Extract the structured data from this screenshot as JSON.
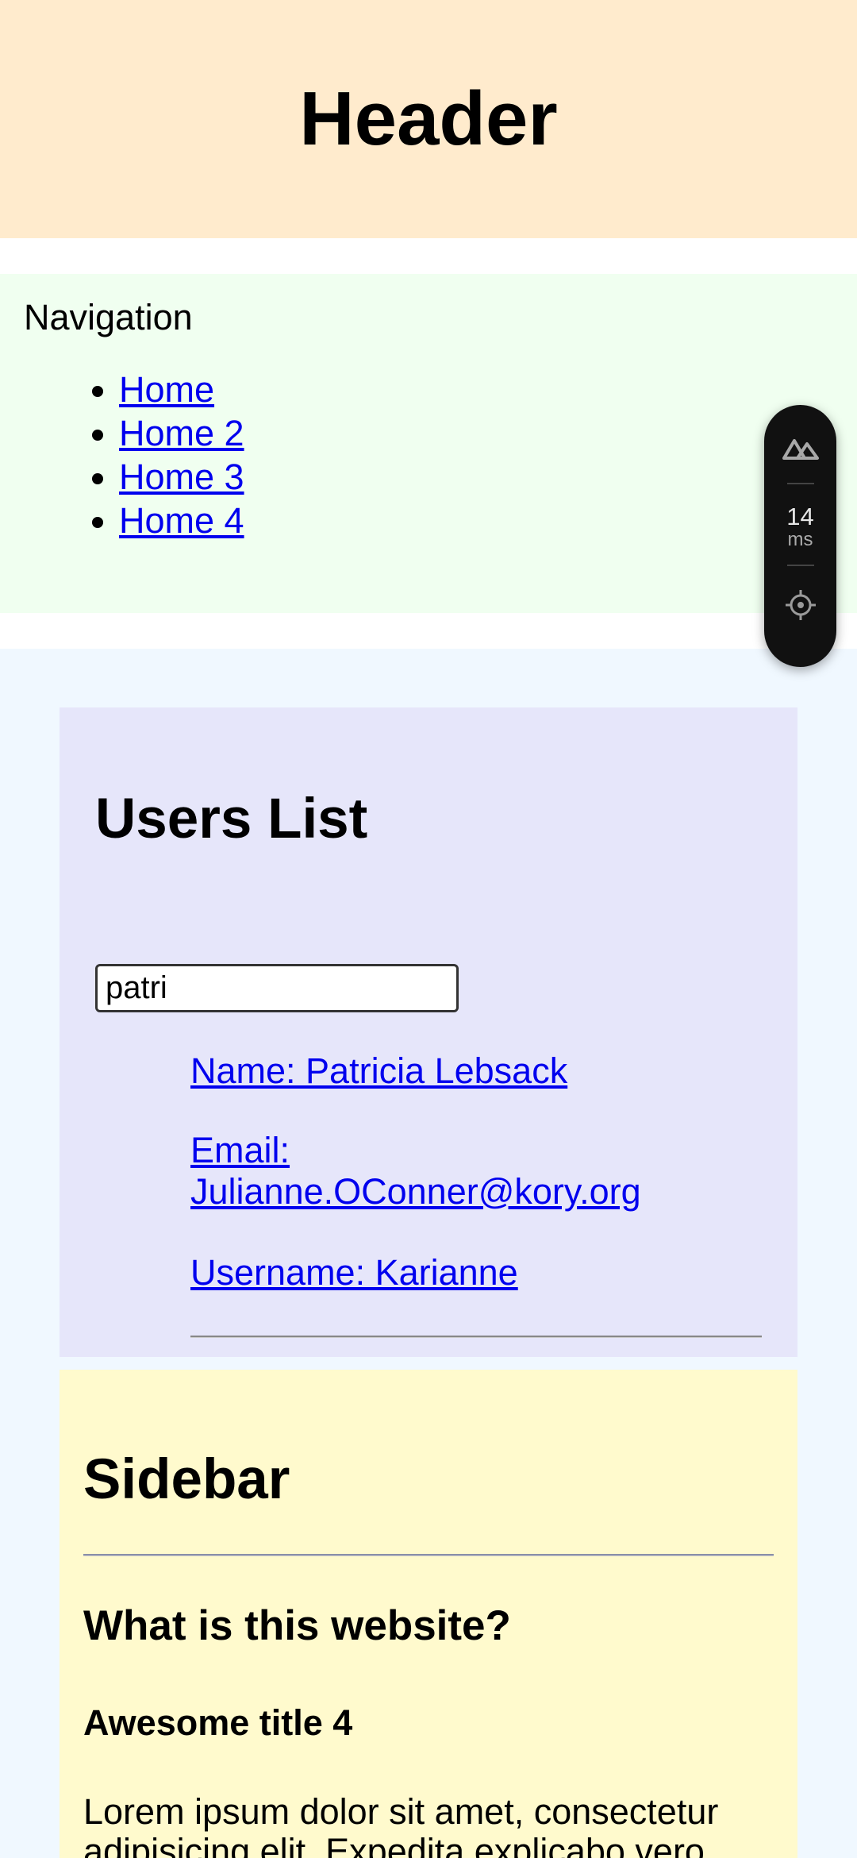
{
  "header": {
    "title": "Header"
  },
  "nav": {
    "title": "Navigation",
    "links": [
      "Home",
      "Home 2",
      "Home 3",
      "Home 4"
    ]
  },
  "users": {
    "title": "Users List",
    "search_value": "patri",
    "name": "Name: Patricia Lebsack",
    "email_line1": "Email:",
    "email_line2": "Julianne.OConner@kory.org",
    "username": "Username: Karianne"
  },
  "sidebar": {
    "title": "Sidebar",
    "question": "What is this website?",
    "subtitle": "Awesome title 4",
    "text": "Lorem ipsum dolor sit amet, consectetur adipisicing elit. Expedita explicabo vero"
  },
  "devtools": {
    "time_value": "14",
    "time_unit": "ms",
    "logo_icon": "nuxt-logo-icon",
    "inspect_icon": "crosshair-icon"
  },
  "colors": {
    "header_bg": "#ffebcd",
    "nav_bg": "#f0fff0",
    "main_bg": "#f0f8ff",
    "users_bg": "#e6e6fa",
    "sidebar_bg": "#fffacd",
    "link": "#0000ee"
  }
}
